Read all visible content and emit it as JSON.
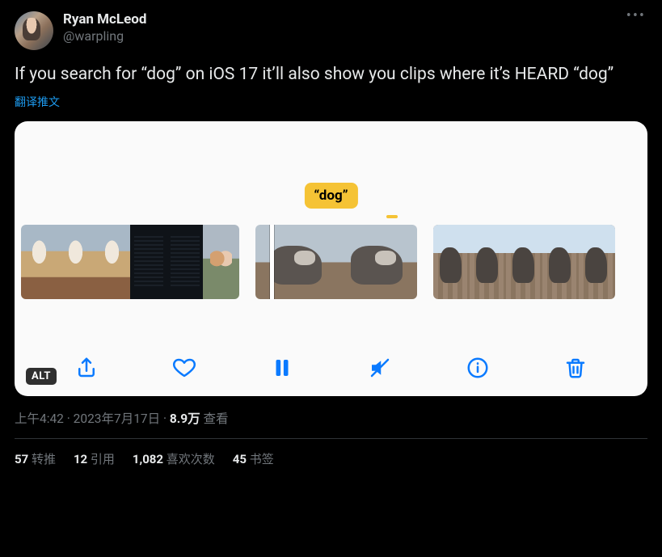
{
  "author": {
    "display_name": "Ryan McLeod",
    "handle": "@warpling"
  },
  "tweet_text": "If you search for “dog” on iOS 17 it’ll also show you clips where it’s HEARD “dog”",
  "translate_label": "翻译推文",
  "media": {
    "search_term_label": "“dog”",
    "alt_badge": "ALT",
    "toolbar": {
      "share": "share-icon",
      "like": "heart-icon",
      "pause": "pause-icon",
      "mute": "mute-icon",
      "info": "info-icon",
      "delete": "trash-icon"
    }
  },
  "meta": {
    "time": "上午4:42",
    "dot1": " · ",
    "date": "2023年7月17日",
    "dot2": " · ",
    "views_count": "8.9万",
    "views_label": " 查看"
  },
  "stats": {
    "retweets_count": "57",
    "retweets_label": " 转推",
    "quotes_count": "12",
    "quotes_label": " 引用",
    "likes_count": "1,082",
    "likes_label": " 喜欢次数",
    "bookmarks_count": "45",
    "bookmarks_label": " 书签"
  }
}
